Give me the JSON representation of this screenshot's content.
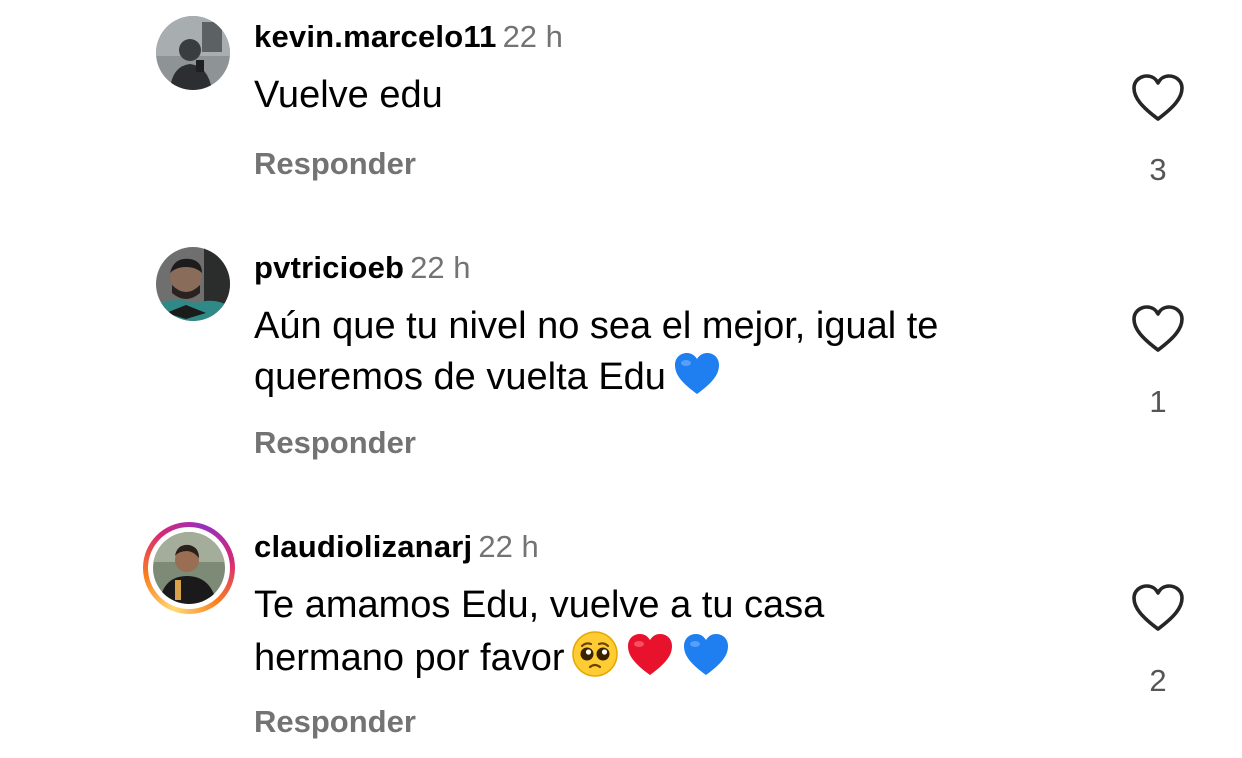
{
  "comments": [
    {
      "username": "kevin.marcelo11",
      "time": "22 h",
      "text": "Vuelve edu",
      "emojis": [],
      "reply_label": "Responder",
      "like_icon": "heart-outline-icon",
      "likes": "3",
      "has_story_ring": false
    },
    {
      "username": "pvtricioeb",
      "time": "22 h",
      "text": "Aún que tu nivel no sea el mejor, igual te queremos de vuelta Edu",
      "emojis": [
        "blue-heart"
      ],
      "reply_label": "Responder",
      "like_icon": "heart-outline-icon",
      "likes": "1",
      "has_story_ring": false
    },
    {
      "username": "claudiolizanarj",
      "time": "22 h",
      "text": "Te amamos Edu, vuelve a tu casa hermano por favor",
      "emojis": [
        "pleading-face",
        "red-heart",
        "blue-heart"
      ],
      "reply_label": "Responder",
      "like_icon": "heart-outline-icon",
      "likes": "2",
      "has_story_ring": true
    }
  ],
  "colors": {
    "text": "#000000",
    "secondary": "#737373",
    "blue_heart": "#1f7ef0",
    "red_heart": "#e8122d",
    "story_ring": [
      "#feda75",
      "#fa7e1e",
      "#d62976",
      "#962fbf"
    ]
  }
}
